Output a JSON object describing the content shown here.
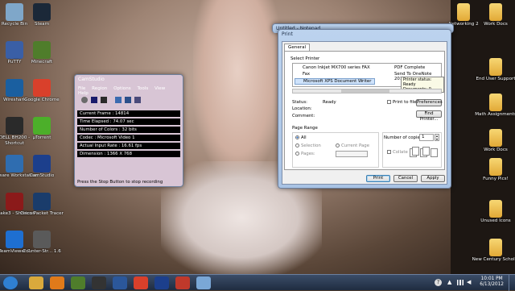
{
  "desktop_left": [
    {
      "label": "Recycle Bin",
      "icon": "recycle-bin-icon",
      "color": "#7fa7c9"
    },
    {
      "label": "Steam",
      "icon": "steam-icon",
      "color": "#1b2838"
    },
    {
      "label": "PuTTY",
      "icon": "putty-icon",
      "color": "#3a5fa6"
    },
    {
      "label": "Minecraft",
      "icon": "minecraft-icon",
      "color": "#4f7d2b"
    },
    {
      "label": "Wireshark",
      "icon": "wireshark-icon",
      "color": "#1a5fa0"
    },
    {
      "label": "Google Chrome",
      "icon": "chrome-icon",
      "color": "#d9402b"
    },
    {
      "label": "DELL BH200 - Shortcut",
      "icon": "dell-icon",
      "color": "#2a2a2a"
    },
    {
      "label": "µTorrent",
      "icon": "utorrent-icon",
      "color": "#4caf2a"
    },
    {
      "label": "VMware Workstation",
      "icon": "vmware-icon",
      "color": "#2f6db0"
    },
    {
      "label": "CamStudio",
      "icon": "camstudio-icon",
      "color": "#1c3f8c"
    },
    {
      "label": "quake3 - Shortcut",
      "icon": "quake-icon",
      "color": "#8b1a1a"
    },
    {
      "label": "Cisco Packet Tracer",
      "icon": "cisco-icon",
      "color": "#1a3c6b"
    },
    {
      "label": "TeamViewer 7",
      "icon": "teamviewer-icon",
      "color": "#1e6fd1"
    },
    {
      "label": "Counter-Str... 1.6",
      "icon": "counter-strike-icon",
      "color": "#5a5a5a"
    }
  ],
  "desktop_right": [
    {
      "label": "Networking 2",
      "icon": "folder-icon"
    },
    {
      "label": "Work Docs",
      "icon": "folder-icon"
    },
    {
      "label": "End User Support",
      "icon": "folder-icon"
    },
    {
      "label": "Math Assignments",
      "icon": "folder-icon"
    },
    {
      "label": "Work Docs",
      "icon": "folder-icon"
    },
    {
      "label": "Funny Pics!",
      "icon": "folder-icon"
    },
    {
      "label": "Unused Icons",
      "icon": "folder-icon"
    },
    {
      "label": "New Century Scholar",
      "icon": "folder-icon"
    }
  ],
  "camstudio": {
    "title": "CamStudio",
    "menu": [
      "File",
      "Region",
      "Options",
      "Tools",
      "View",
      "Help"
    ],
    "stats": [
      "Current Frame : 14814",
      "Time Elapsed : 74.07 sec",
      "Number of Colors : 32 bits",
      "Codec : Microsoft Video 1",
      "Actual Input Rate : 16.61 fps",
      "Dimension : 1366 X 768"
    ],
    "status": "Press the Stop Button to stop recording"
  },
  "notepad_title": "Untitled - Notepad",
  "print_dialog": {
    "title": "Print",
    "tab": "General",
    "select_printer_label": "Select Printer",
    "printers": [
      "Canon Inkjet MX700 series FAX",
      "PDF Complete",
      "Fax",
      "Send To OneNote 2010",
      "Microsoft XPS Document Writer"
    ],
    "tooltip_lines": [
      "Printer status: Ready",
      "Documents: 0"
    ],
    "status_label": "Status:",
    "status_value": "Ready",
    "location_label": "Location:",
    "comment_label": "Comment:",
    "print_to_file": "Print to file",
    "preferences": "Preferences",
    "find_printer": "Find Printer...",
    "page_range_label": "Page Range",
    "all": "All",
    "selection": "Selection",
    "current_page": "Current Page",
    "pages": "Pages:",
    "copies_label": "Number of copies:",
    "copies_value": "1",
    "collate": "Collate",
    "print": "Print",
    "cancel": "Cancel",
    "apply": "Apply"
  },
  "taskbar": {
    "time": "10:01 PM",
    "date": "6/13/2012",
    "items": [
      {
        "icon": "start-orb-icon",
        "color": "#2f7fd1"
      },
      {
        "icon": "folder-explorer-icon",
        "color": "#d9a93c"
      },
      {
        "icon": "media-player-icon",
        "color": "#e07a1a"
      },
      {
        "icon": "minecraft-icon",
        "color": "#4f7d2b"
      },
      {
        "icon": "terminal-icon",
        "color": "#333333"
      },
      {
        "icon": "word-icon",
        "color": "#2b579a"
      },
      {
        "icon": "chrome-icon",
        "color": "#d9402b"
      },
      {
        "icon": "camstudio-icon",
        "color": "#1c3f8c"
      },
      {
        "icon": "recorder-icon",
        "color": "#c0392b"
      },
      {
        "icon": "notepad-icon",
        "color": "#7aa7d6"
      }
    ]
  }
}
